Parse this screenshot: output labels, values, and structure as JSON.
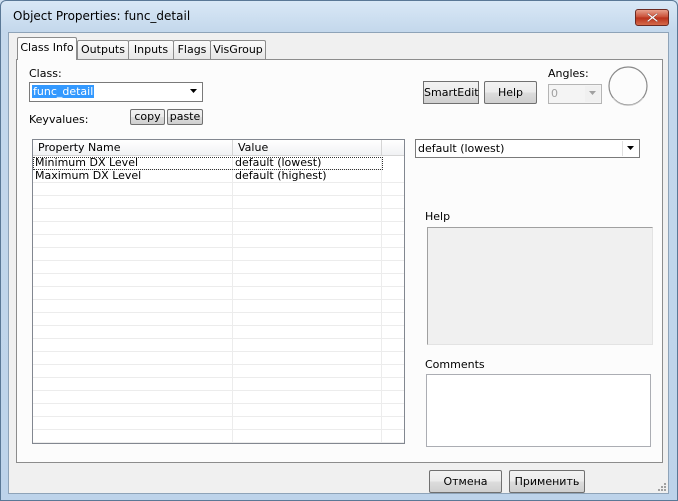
{
  "window": {
    "title": "Object Properties: func_detail"
  },
  "tabs": [
    {
      "label": "Class Info",
      "active": true
    },
    {
      "label": "Outputs",
      "active": false
    },
    {
      "label": "Inputs",
      "active": false
    },
    {
      "label": "Flags",
      "active": false
    },
    {
      "label": "VisGroup",
      "active": false
    }
  ],
  "class_info": {
    "class_label": "Class:",
    "class_value": "func_detail",
    "keyvalues_label": "Keyvalues:",
    "copy_label": "copy",
    "paste_label": "paste",
    "smartedit_label": "SmartEdit",
    "help_button_label": "Help",
    "angles_label": "Angles:",
    "angles_value": "0",
    "table": {
      "columns": [
        "Property Name",
        "Value"
      ],
      "rows": [
        {
          "name": "Minimum DX Level",
          "value": "default (lowest)",
          "selected": true
        },
        {
          "name": "Maximum DX Level",
          "value": "default (highest)",
          "selected": false
        }
      ]
    },
    "value_combo": "default (lowest)",
    "help_label": "Help",
    "comments_label": "Comments"
  },
  "footer": {
    "cancel_label": "Отмена",
    "apply_label": "Применить"
  },
  "colors": {
    "selection": "#3399ff",
    "panel": "#fcfcfc",
    "dialog": "#f0f0f0"
  }
}
